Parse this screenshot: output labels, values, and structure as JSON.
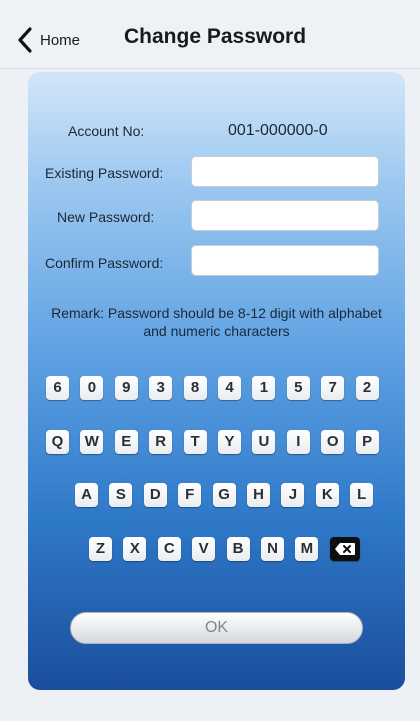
{
  "nav": {
    "back_label": "Home",
    "title": "Change Password"
  },
  "form": {
    "account_label": "Account No:",
    "account_value": "001-000000-0",
    "existing_label": "Existing Password:",
    "existing_value": "",
    "new_label": "New Password:",
    "new_value": "",
    "confirm_label": "Confirm Password:",
    "confirm_value": "",
    "remark": "Remark: Password should be 8-12 digit with alphabet and numeric characters"
  },
  "keyboard": {
    "row1": [
      "6",
      "0",
      "9",
      "3",
      "8",
      "4",
      "1",
      "5",
      "7",
      "2"
    ],
    "row2": [
      "Q",
      "W",
      "E",
      "R",
      "T",
      "Y",
      "U",
      "I",
      "O",
      "P"
    ],
    "row3": [
      "A",
      "S",
      "D",
      "F",
      "G",
      "H",
      "J",
      "K",
      "L"
    ],
    "row4": [
      "Z",
      "X",
      "C",
      "V",
      "B",
      "N",
      "M"
    ],
    "delete_icon": "backspace-icon"
  },
  "ok_label": "OK",
  "colors": {
    "panel_top": "#d2e6fa",
    "panel_bottom": "#1a4e9c",
    "nav_bg": "#eef2f7"
  }
}
